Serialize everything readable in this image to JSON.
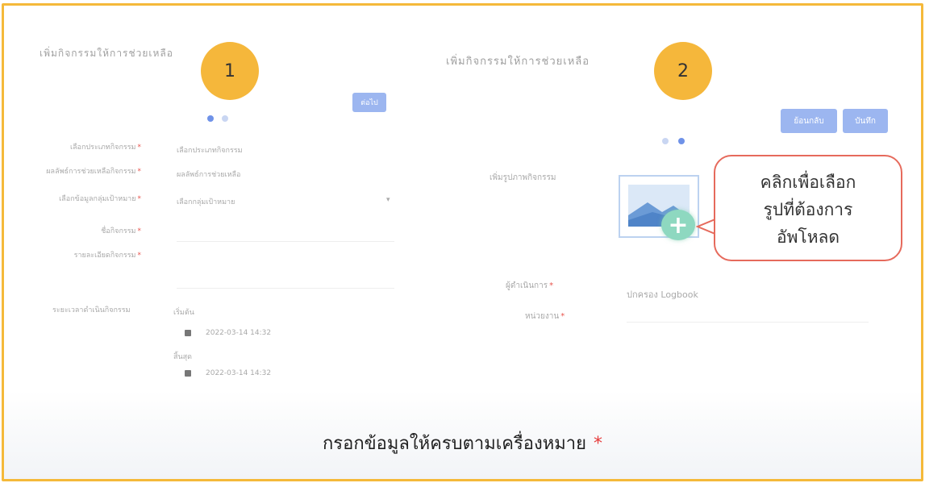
{
  "step1": {
    "badge": "1",
    "title": "เพิ่มกิจกรรมให้การช่วยเหลือ",
    "next_button": "ต่อไป",
    "fields": [
      {
        "label": "เลือกประเภทกิจกรรม",
        "value": "เลือกประเภทกิจกรรม"
      },
      {
        "label": "ผลลัพธ์การช่วยเหลือกิจกรรม",
        "value": "ผลลัพธ์การช่วยเหลือ"
      },
      {
        "label": "เลือกข้อมูลกลุ่มเป้าหมาย",
        "value": "เลือกกลุ่มเป้าหมาย"
      },
      {
        "label": "ชื่อกิจกรรม",
        "value": ""
      },
      {
        "label": "รายละเอียดกิจกรรม",
        "value": ""
      }
    ],
    "period_label": "ระยะเวลาดำเนินกิจกรรม",
    "start_label": "เริ่มต้น",
    "start_value": "2022-03-14 14:32",
    "end_label": "สิ้นสุด",
    "end_value": "2022-03-14 14:32"
  },
  "step2": {
    "badge": "2",
    "title": "เพิ่มกิจกรรมให้การช่วยเหลือ",
    "back_button": "ย้อนกลับ",
    "save_button": "บันทึก",
    "image_label": "เพิ่มรูปภาพกิจกรรม",
    "operator_label": "ผู้ดำเนินการ",
    "operator_value": "ปกครอง Logbook",
    "agency_label": "หน่วยงาน"
  },
  "callout": {
    "line1": "คลิกเพื่อเลือก",
    "line2": "รูปที่ต้องการ",
    "line3": "อัพโหลด"
  },
  "footer": {
    "text": "กรอกข้อมูลให้ครบตามเครื่องหมาย",
    "asterisk": "*"
  },
  "colors": {
    "frame": "#f5b93a",
    "badge": "#f5b73b",
    "button": "#9cb6f0",
    "required": "#e8554e",
    "callout_border": "#e66a5c",
    "plus_circle": "#8ed8c0"
  }
}
